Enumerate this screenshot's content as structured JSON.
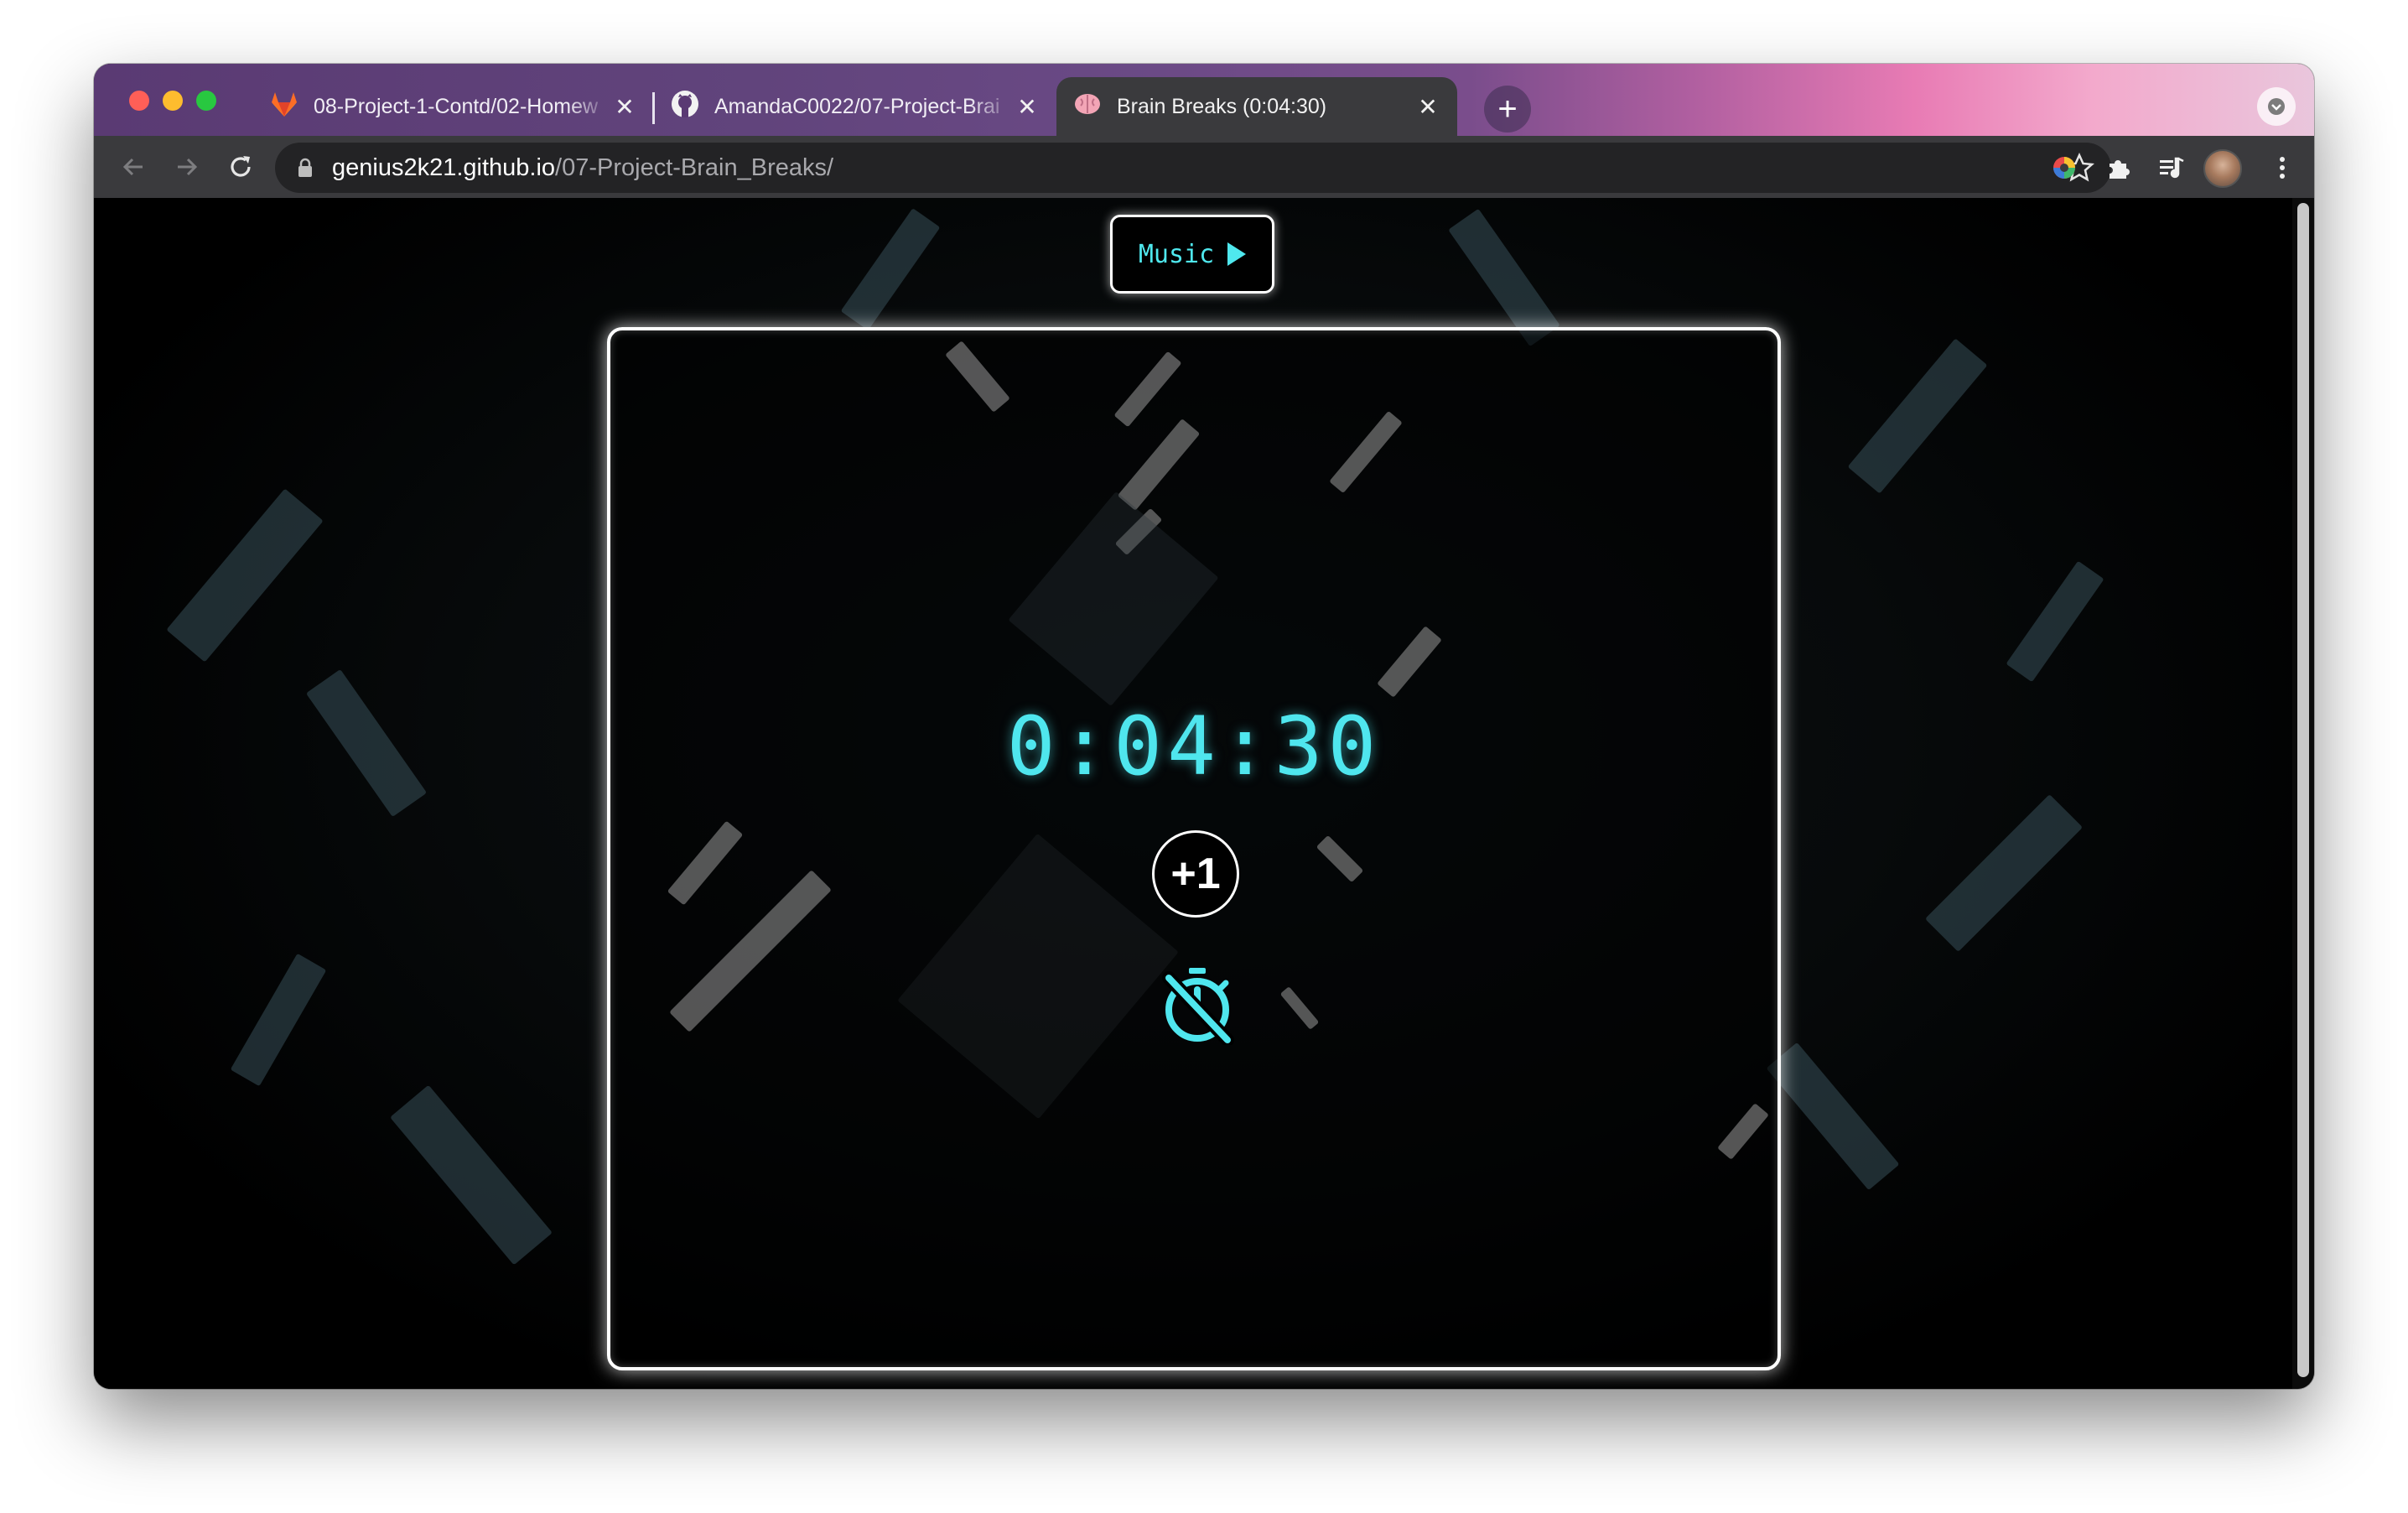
{
  "browser": {
    "tabs": [
      {
        "title": "08-Project-1-Contd/02-Homew",
        "icon": "gitlab-icon",
        "active": false
      },
      {
        "title": "AmandaC0022/07-Project-Brai",
        "icon": "github-icon",
        "active": false
      },
      {
        "title": "Brain Breaks (0:04:30)",
        "icon": "brain-icon",
        "active": true
      }
    ],
    "url_host": "genius2k21.github.io",
    "url_path": "/07-Project-Brain_Breaks/",
    "new_tab_label": "+",
    "close_label": "✕"
  },
  "app": {
    "music_label": "Music",
    "timer": "0:04:30",
    "add_minute_label": "+1",
    "timer_off_icon": "timer-off-icon",
    "accent_color": "#4fe6ee"
  }
}
